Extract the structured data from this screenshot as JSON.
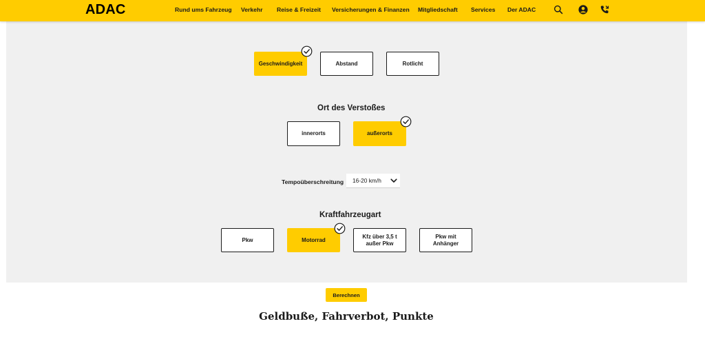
{
  "header": {
    "logo": "ADAC",
    "nav": [
      "Rund ums Fahrzeug",
      "Verkehr",
      "Reise & Freizeit",
      "Versicherungen & Finanzen",
      "Mitgliedschaft",
      "Services",
      "Der ADAC"
    ],
    "icons": [
      "search-icon",
      "account-icon",
      "phone-icon"
    ]
  },
  "violation_type": {
    "options": [
      "Geschwindigkeit",
      "Abstand",
      "Rotlicht"
    ],
    "selected": "Geschwindigkeit"
  },
  "location": {
    "title": "Ort des Verstoßes",
    "options": [
      "innerorts",
      "außerorts"
    ],
    "selected": "außerorts"
  },
  "speeding": {
    "label": "Tempoüberschreitung",
    "value": "16-20 km/h"
  },
  "vehicle": {
    "title": "Kraftfahrzeugart",
    "options": [
      "Pkw",
      "Motorrad",
      "Kfz über 3,5 t außer Pkw",
      "Pkw mit Anhänger"
    ],
    "selected": "Motorrad"
  },
  "calculate_label": "Berechnen",
  "result_title": "Geldbuße, Fahrverbot, Punkte",
  "colors": {
    "brand_yellow": "#ffcc00",
    "panel_grey": "#f0f0f0",
    "text": "#1a1a1a"
  }
}
